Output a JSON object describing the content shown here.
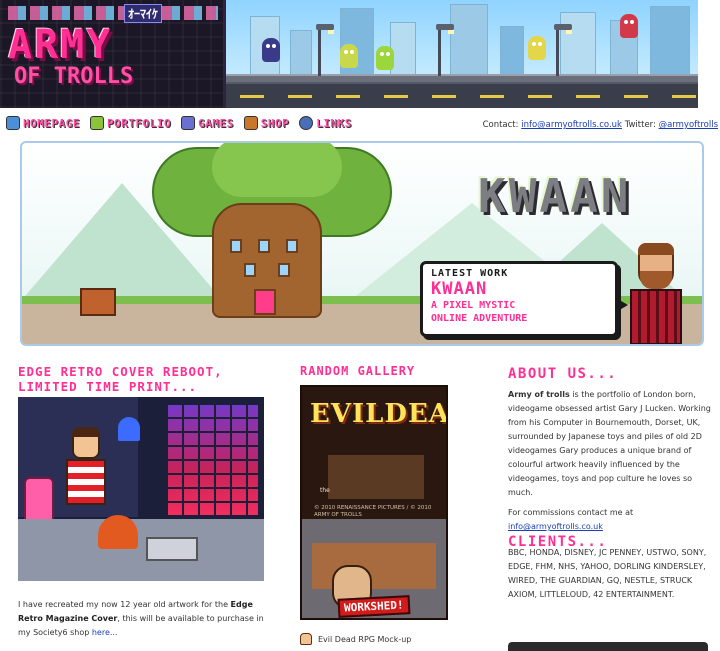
{
  "header": {
    "logo_line1": "ARMY",
    "logo_line2": "OF TROLLS",
    "logo_jp": "ｵｰﾏｲｹ"
  },
  "nav": {
    "items": [
      {
        "label": "HOMEPAGE",
        "icon": "computer-icon",
        "color": "#4a8fd8"
      },
      {
        "label": "PORTFOLIO",
        "icon": "gameboy-icon",
        "color": "#8ac43a"
      },
      {
        "label": "GAMES",
        "icon": "joystick-icon",
        "color": "#6b6fd0"
      },
      {
        "label": "SHOP",
        "icon": "treasure-chest-icon",
        "color": "#c9782a"
      },
      {
        "label": "LINKS",
        "icon": "globe-icon",
        "color": "#4a6fb8"
      }
    ]
  },
  "contact": {
    "prefix": "Contact:",
    "email": "info@armyoftrolls.co.uk",
    "twitter_prefix": "Twitter:",
    "twitter": "@armyoftrolls"
  },
  "hero": {
    "title": "KWAAN",
    "bubble_label": "LATEST WORK",
    "bubble_title": "KWAAN",
    "bubble_line1": "A PIXEL MYSTIC",
    "bubble_line2": "ONLINE ADVENTURE"
  },
  "col1": {
    "heading_line1": "EDGE RETRO COVER REBOOT,",
    "heading_line2": "LIMITED TIME PRINT...",
    "text_a": "I have recreated my now 12 year old artwork for the ",
    "text_b": "Edge Retro Magazine Cover",
    "text_c": ", this will be available to purchase in my Society6 shop ",
    "link": "here..."
  },
  "col2": {
    "heading": "RANDOM GALLERY",
    "art_title": "EVILDEAD",
    "art_tag": "the",
    "art_credits": "© 2010 RENAISSANCE PICTURES / © 2010 ARMY OF TROLLS",
    "art_stamp": "WORKSHED!",
    "caption": "Evil Dead RPG Mock-up"
  },
  "col3": {
    "heading": "ABOUT US...",
    "about_bold": "Army of trolls",
    "about_text": " is the portfolio of London born, videogame obsessed artist Gary J Lucken. Working from his Computer in Bournemouth, Dorset, UK, surrounded by Japanese toys and piles of old 2D videogames Gary produces a unique brand of colourful artwork heavily influenced by the videogames, toys and pop culture he loves so much.",
    "commission_text": "For commissions contact me at",
    "commission_email": "info@armyoftrolls.co.uk",
    "clients_heading": "CLIENTS...",
    "clients": "BBC, HONDA, DISNEY, JC PENNEY, USTWO, SONY, EDGE, FHM, NHS, YAHOO, DORLING KINDERSLEY, WIRED, THE GUARDIAN, GQ, NESTLE, STRUCK AXIOM, LITTLELOUD, 42 ENTERTAINMENT."
  },
  "colors": {
    "brand_pink": "#ff2f94",
    "link_blue": "#1a3fb5"
  }
}
